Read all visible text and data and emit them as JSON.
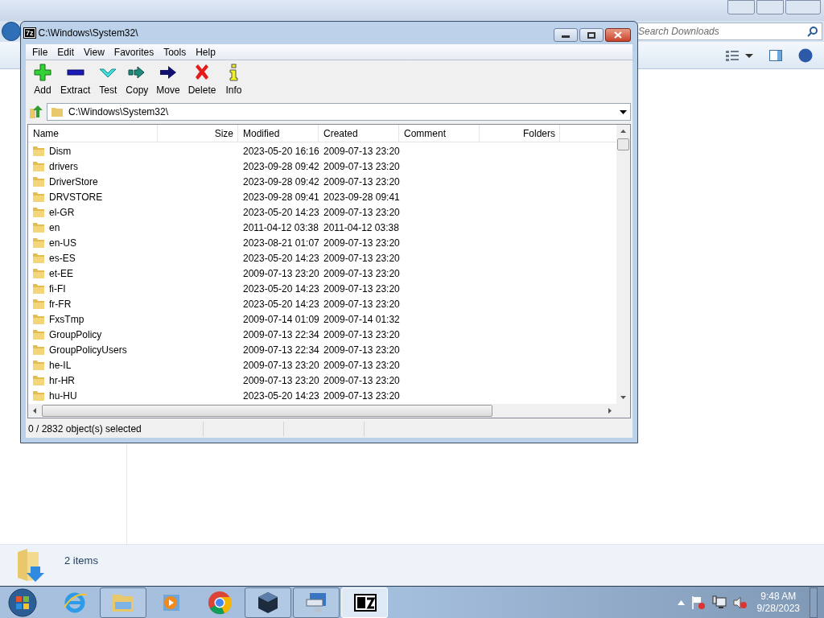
{
  "background_window": {
    "search": {
      "placeholder": "Search Downloads"
    },
    "status_bar": "2 items"
  },
  "window": {
    "title": "C:\\Windows\\System32\\",
    "app_icon": "7z"
  },
  "menu": [
    "File",
    "Edit",
    "View",
    "Favorites",
    "Tools",
    "Help"
  ],
  "toolbar": [
    {
      "kind": "add",
      "label": "Add"
    },
    {
      "kind": "extract",
      "label": "Extract"
    },
    {
      "kind": "test",
      "label": "Test"
    },
    {
      "kind": "copy",
      "label": "Copy"
    },
    {
      "kind": "move",
      "label": "Move"
    },
    {
      "kind": "delete",
      "label": "Delete"
    },
    {
      "kind": "info",
      "label": "Info"
    }
  ],
  "address": "C:\\Windows\\System32\\",
  "table": {
    "columns": [
      "Name",
      "Size",
      "Modified",
      "Created",
      "Comment",
      "Folders"
    ],
    "rows": [
      {
        "name": "Dism",
        "modified": "2023-05-20 16:16",
        "created": "2009-07-13 23:20"
      },
      {
        "name": "drivers",
        "modified": "2023-09-28 09:42",
        "created": "2009-07-13 23:20"
      },
      {
        "name": "DriverStore",
        "modified": "2023-09-28 09:42",
        "created": "2009-07-13 23:20"
      },
      {
        "name": "DRVSTORE",
        "modified": "2023-09-28 09:41",
        "created": "2023-09-28 09:41"
      },
      {
        "name": "el-GR",
        "modified": "2023-05-20 14:23",
        "created": "2009-07-13 23:20"
      },
      {
        "name": "en",
        "modified": "2011-04-12 03:38",
        "created": "2011-04-12 03:38"
      },
      {
        "name": "en-US",
        "modified": "2023-08-21 01:07",
        "created": "2009-07-13 23:20"
      },
      {
        "name": "es-ES",
        "modified": "2023-05-20 14:23",
        "created": "2009-07-13 23:20"
      },
      {
        "name": "et-EE",
        "modified": "2009-07-13 23:20",
        "created": "2009-07-13 23:20"
      },
      {
        "name": "fi-FI",
        "modified": "2023-05-20 14:23",
        "created": "2009-07-13 23:20"
      },
      {
        "name": "fr-FR",
        "modified": "2023-05-20 14:23",
        "created": "2009-07-13 23:20"
      },
      {
        "name": "FxsTmp",
        "modified": "2009-07-14 01:09",
        "created": "2009-07-14 01:32"
      },
      {
        "name": "GroupPolicy",
        "modified": "2009-07-13 22:34",
        "created": "2009-07-13 23:20"
      },
      {
        "name": "GroupPolicyUsers",
        "modified": "2009-07-13 22:34",
        "created": "2009-07-13 23:20"
      },
      {
        "name": "he-IL",
        "modified": "2009-07-13 23:20",
        "created": "2009-07-13 23:20"
      },
      {
        "name": "hr-HR",
        "modified": "2009-07-13 23:20",
        "created": "2009-07-13 23:20"
      },
      {
        "name": "hu-HU",
        "modified": "2023-05-20 14:23",
        "created": "2009-07-13 23:20"
      }
    ]
  },
  "status_bar": "0 / 2832 object(s) selected",
  "taskbar": {
    "items": [
      {
        "kind": "ie",
        "selected": false
      },
      {
        "kind": "explorer",
        "selected": false
      },
      {
        "kind": "media",
        "selected": false
      },
      {
        "kind": "chrome",
        "selected": false
      },
      {
        "kind": "vbox",
        "selected": false
      },
      {
        "kind": "remote",
        "selected": false
      },
      {
        "kind": "sevenzip",
        "selected": true
      }
    ],
    "time": "9:48 AM",
    "date": "9/28/2023"
  }
}
